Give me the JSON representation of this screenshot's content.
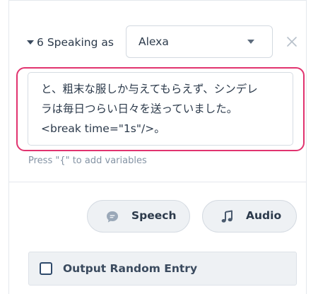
{
  "step": {
    "number": "6",
    "speaking_label": "Speaking as"
  },
  "voice_select": {
    "value": "Alexa"
  },
  "editor": {
    "lines": [
      "と、粗末な服しか与えてもらえず、シンデレ",
      "ラは毎日つらい日々を送っていました。",
      "<break time=\"1s\"/>。"
    ]
  },
  "hint": "Press \"{\" to add variables",
  "buttons": {
    "speech": "Speech",
    "audio": "Audio"
  },
  "random_entry": {
    "label": "Output Random Entry",
    "checked": false
  },
  "icons": {
    "caret": "caret-down-icon",
    "select_caret": "chevron-down-icon",
    "close": "close-icon",
    "speech": "speech-bubble-icon",
    "audio": "music-note-icon"
  },
  "colors": {
    "focus_border": "#e1336f",
    "text": "#2c3a4b",
    "hint": "#8493a4",
    "button_bg": "#eef1f4"
  }
}
